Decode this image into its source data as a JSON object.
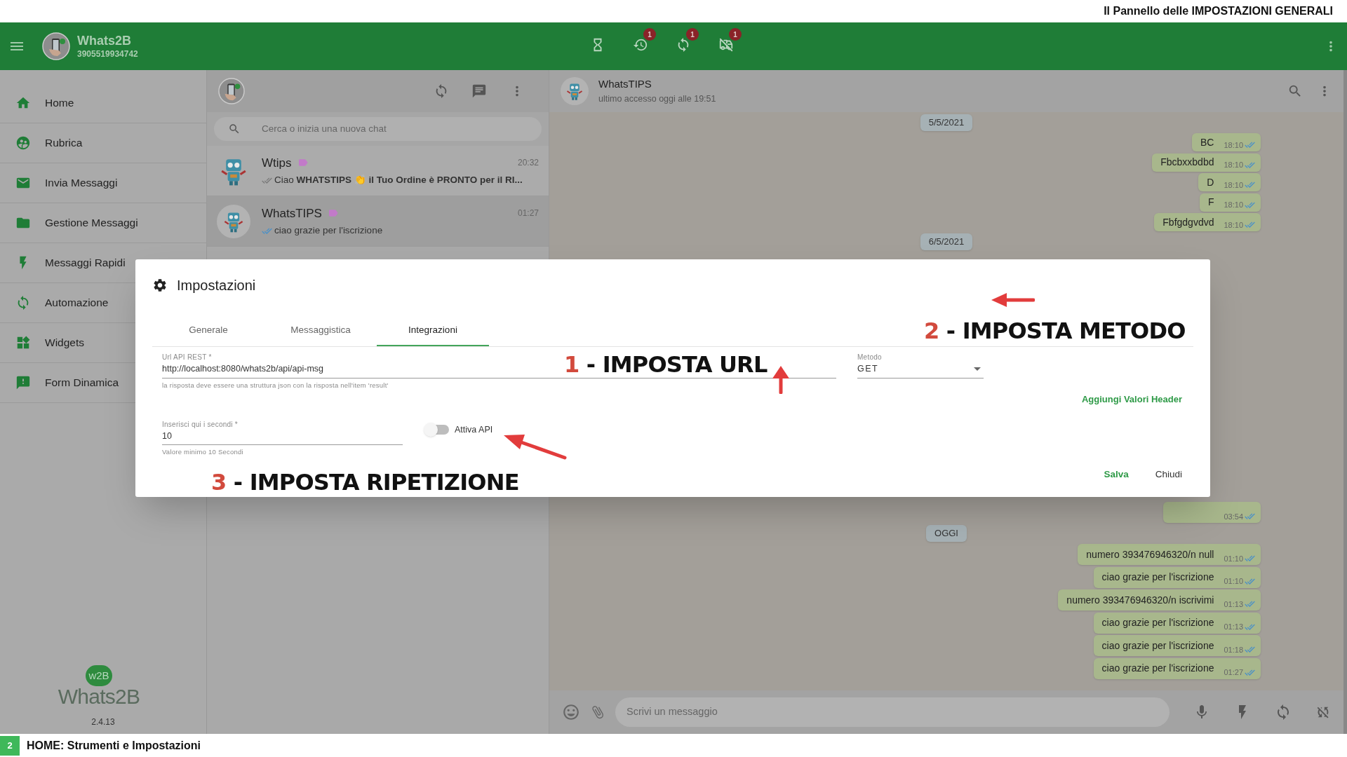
{
  "slide_title": "Il Pannello delle IMPOSTAZIONI GENERALI",
  "app_header": {
    "name": "Whats2B",
    "number": "3905519934742",
    "tool_badges": [
      "1",
      "1",
      "1"
    ]
  },
  "sidebar": {
    "items": [
      {
        "label": "Home"
      },
      {
        "label": "Rubrica"
      },
      {
        "label": "Invia Messaggi"
      },
      {
        "label": "Gestione Messaggi"
      },
      {
        "label": "Messaggi Rapidi"
      },
      {
        "label": "Automazione"
      },
      {
        "label": "Widgets"
      },
      {
        "label": "Form Dinamica"
      }
    ],
    "logo": {
      "badge": "w2B",
      "name": "Whats2B"
    },
    "version": "2.4.13"
  },
  "chat_list": {
    "search": {
      "placeholder": "Cerca o inizia una nuova chat"
    },
    "chats": [
      {
        "name": "Wtips",
        "time": "20:32",
        "preview": "Ciao **WHATSTIPS 👏 il Tuo Ordine è PRONTO per il RI...**",
        "read": false,
        "selected": false
      },
      {
        "name": "WhatsTIPS",
        "time": "01:27",
        "preview": "ciao grazie per l'iscrizione",
        "read": true,
        "selected": true
      }
    ]
  },
  "conversation": {
    "name": "WhatsTIPS",
    "status": "ultimo accesso oggi alle 19:51",
    "top_items": [
      {
        "kind": "date",
        "text": "5/5/2021"
      },
      {
        "kind": "message",
        "text": "BC",
        "time": "18:10"
      },
      {
        "kind": "message",
        "text": "Fbcbxxbdbd",
        "time": "18:10"
      },
      {
        "kind": "message",
        "text": "D",
        "time": "18:10"
      },
      {
        "kind": "message",
        "text": "F",
        "time": "18:10"
      },
      {
        "kind": "message",
        "text": "Fbfgdgvdvd",
        "time": "18:10"
      },
      {
        "kind": "date",
        "text": "6/5/2021"
      }
    ],
    "bottom_items": [
      {
        "kind": "message",
        "time": "03:54"
      },
      {
        "kind": "date",
        "text": "OGGI"
      },
      {
        "kind": "message",
        "text": "numero 393476946320/n null",
        "time": "01:10"
      },
      {
        "kind": "message",
        "text": "ciao grazie per l'iscrizione",
        "time": "01:10"
      },
      {
        "kind": "message",
        "text": "numero 393476946320/n iscrivimi",
        "time": "01:13"
      },
      {
        "kind": "message",
        "text": "ciao grazie per l'iscrizione",
        "time": "01:13"
      },
      {
        "kind": "message",
        "text": "ciao grazie per l'iscrizione",
        "time": "01:18"
      },
      {
        "kind": "message",
        "text": "ciao grazie per l'iscrizione",
        "time": "01:27"
      }
    ],
    "composer": {
      "placeholder": "Scrivi un messaggio"
    }
  },
  "dialog": {
    "title": "Impostazioni",
    "tabs": [
      {
        "label": "Generale",
        "selected": false
      },
      {
        "label": "Messaggistica",
        "selected": false
      },
      {
        "label": "Integrazioni",
        "selected": true
      }
    ],
    "url_field": {
      "label": "Url API REST *",
      "value": "http://localhost:8080/whats2b/api/api-msg",
      "hint": "la risposta deve essere una struttura json con la risposta nell'item 'result'"
    },
    "method_field": {
      "label": "Metodo",
      "value": "GET"
    },
    "header_link": "Aggiungi Valori Header",
    "seconds_field": {
      "label": "Inserisci qui i secondi *",
      "value": "10",
      "hint": "Valore minimo 10 Secondi"
    },
    "api_switch": {
      "label": "Attiva API",
      "on": false
    },
    "buttons": [
      "Salva",
      "Chiudi"
    ]
  },
  "callouts": [
    {
      "number": "1",
      "text": "- IMPOSTA URL"
    },
    {
      "number": "2",
      "text": "- IMPOSTA METODO"
    },
    {
      "number": "3",
      "text": "- IMPOSTA RIPETIZIONE"
    }
  ],
  "footer": {
    "page": "2",
    "title": "HOME: Strumenti e Impostazioni"
  }
}
